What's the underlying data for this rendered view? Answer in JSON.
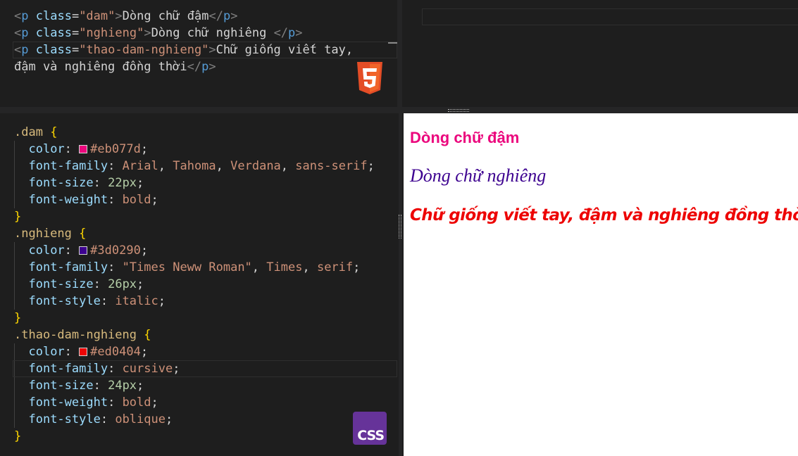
{
  "html_editor": {
    "lines": [
      [
        {
          "cls": "tag",
          "t": "<"
        },
        {
          "cls": "tname",
          "t": "p"
        },
        {
          "cls": "txt",
          "t": " "
        },
        {
          "cls": "attr",
          "t": "class"
        },
        {
          "cls": "txt",
          "t": "="
        },
        {
          "cls": "str",
          "t": "\"dam\""
        },
        {
          "cls": "tag",
          "t": ">"
        },
        {
          "cls": "txt",
          "t": "Dòng chữ đậm"
        },
        {
          "cls": "tag",
          "t": "</"
        },
        {
          "cls": "tname",
          "t": "p"
        },
        {
          "cls": "tag",
          "t": ">"
        }
      ],
      [
        {
          "cls": "tag",
          "t": "<"
        },
        {
          "cls": "tname",
          "t": "p"
        },
        {
          "cls": "txt",
          "t": " "
        },
        {
          "cls": "attr",
          "t": "class"
        },
        {
          "cls": "txt",
          "t": "="
        },
        {
          "cls": "str",
          "t": "\"nghieng\""
        },
        {
          "cls": "tag",
          "t": ">"
        },
        {
          "cls": "txt",
          "t": "Dòng chữ nghiêng "
        },
        {
          "cls": "tag",
          "t": "</"
        },
        {
          "cls": "tname",
          "t": "p"
        },
        {
          "cls": "tag",
          "t": ">"
        }
      ],
      [
        {
          "cls": "tag",
          "t": "<"
        },
        {
          "cls": "tname",
          "t": "p"
        },
        {
          "cls": "txt",
          "t": " "
        },
        {
          "cls": "attr",
          "t": "class"
        },
        {
          "cls": "txt",
          "t": "="
        },
        {
          "cls": "str",
          "t": "\"thao-dam-nghieng\""
        },
        {
          "cls": "tag",
          "t": ">"
        },
        {
          "cls": "txt",
          "t": "Chữ giống viết tay,"
        }
      ],
      [
        {
          "cls": "txt",
          "t": "đậm và nghiêng đồng thời"
        },
        {
          "cls": "tag",
          "t": "</"
        },
        {
          "cls": "tname",
          "t": "p"
        },
        {
          "cls": "tag",
          "t": ">"
        }
      ]
    ]
  },
  "css_editor": {
    "lines": [
      [
        {
          "cls": "sel",
          "t": ".dam"
        },
        {
          "cls": "txt",
          "t": " "
        },
        {
          "cls": "brace",
          "t": "{"
        }
      ],
      [
        {
          "cls": "txt",
          "t": "  "
        },
        {
          "cls": "prop",
          "t": "color"
        },
        {
          "cls": "punc",
          "t": ": "
        },
        {
          "swatch": "#eb077d"
        },
        {
          "cls": "val",
          "t": "#eb077d"
        },
        {
          "cls": "punc",
          "t": ";"
        }
      ],
      [
        {
          "cls": "txt",
          "t": "  "
        },
        {
          "cls": "prop",
          "t": "font-family"
        },
        {
          "cls": "punc",
          "t": ": "
        },
        {
          "cls": "val",
          "t": "Arial"
        },
        {
          "cls": "punc",
          "t": ", "
        },
        {
          "cls": "val",
          "t": "Tahoma"
        },
        {
          "cls": "punc",
          "t": ", "
        },
        {
          "cls": "val",
          "t": "Verdana"
        },
        {
          "cls": "punc",
          "t": ", "
        },
        {
          "cls": "val",
          "t": "sans-serif"
        },
        {
          "cls": "punc",
          "t": ";"
        }
      ],
      [
        {
          "cls": "txt",
          "t": "  "
        },
        {
          "cls": "prop",
          "t": "font-size"
        },
        {
          "cls": "punc",
          "t": ": "
        },
        {
          "cls": "num",
          "t": "22px"
        },
        {
          "cls": "punc",
          "t": ";"
        }
      ],
      [
        {
          "cls": "txt",
          "t": "  "
        },
        {
          "cls": "prop",
          "t": "font-weight"
        },
        {
          "cls": "punc",
          "t": ": "
        },
        {
          "cls": "val",
          "t": "bold"
        },
        {
          "cls": "punc",
          "t": ";"
        }
      ],
      [
        {
          "cls": "brace",
          "t": "}"
        }
      ],
      [
        {
          "cls": "sel",
          "t": ".nghieng"
        },
        {
          "cls": "txt",
          "t": " "
        },
        {
          "cls": "brace",
          "t": "{"
        }
      ],
      [
        {
          "cls": "txt",
          "t": "  "
        },
        {
          "cls": "prop",
          "t": "color"
        },
        {
          "cls": "punc",
          "t": ": "
        },
        {
          "swatch": "#3d0290"
        },
        {
          "cls": "val",
          "t": "#3d0290"
        },
        {
          "cls": "punc",
          "t": ";"
        }
      ],
      [
        {
          "cls": "txt",
          "t": "  "
        },
        {
          "cls": "prop",
          "t": "font-family"
        },
        {
          "cls": "punc",
          "t": ": "
        },
        {
          "cls": "val",
          "t": "\"Times Neww Roman\""
        },
        {
          "cls": "punc",
          "t": ", "
        },
        {
          "cls": "val",
          "t": "Times"
        },
        {
          "cls": "punc",
          "t": ", "
        },
        {
          "cls": "val",
          "t": "serif"
        },
        {
          "cls": "punc",
          "t": ";"
        }
      ],
      [
        {
          "cls": "txt",
          "t": "  "
        },
        {
          "cls": "prop",
          "t": "font-size"
        },
        {
          "cls": "punc",
          "t": ": "
        },
        {
          "cls": "num",
          "t": "26px"
        },
        {
          "cls": "punc",
          "t": ";"
        }
      ],
      [
        {
          "cls": "txt",
          "t": "  "
        },
        {
          "cls": "prop",
          "t": "font-style"
        },
        {
          "cls": "punc",
          "t": ": "
        },
        {
          "cls": "val",
          "t": "italic"
        },
        {
          "cls": "punc",
          "t": ";"
        }
      ],
      [
        {
          "cls": "brace",
          "t": "}"
        }
      ],
      [
        {
          "cls": "sel",
          "t": ".thao-dam-nghieng"
        },
        {
          "cls": "txt",
          "t": " "
        },
        {
          "cls": "brace",
          "t": "{"
        }
      ],
      [
        {
          "cls": "txt",
          "t": "  "
        },
        {
          "cls": "prop",
          "t": "color"
        },
        {
          "cls": "punc",
          "t": ": "
        },
        {
          "swatch": "#ed0404"
        },
        {
          "cls": "val",
          "t": "#ed0404"
        },
        {
          "cls": "punc",
          "t": ";"
        }
      ],
      [
        {
          "cls": "txt",
          "t": "  "
        },
        {
          "cls": "prop",
          "t": "font-family"
        },
        {
          "cls": "punc",
          "t": ": "
        },
        {
          "cls": "val",
          "t": "cursive"
        },
        {
          "cls": "punc",
          "t": ";"
        }
      ],
      [
        {
          "cls": "txt",
          "t": "  "
        },
        {
          "cls": "prop",
          "t": "font-size"
        },
        {
          "cls": "punc",
          "t": ": "
        },
        {
          "cls": "num",
          "t": "24px"
        },
        {
          "cls": "punc",
          "t": ";"
        }
      ],
      [
        {
          "cls": "txt",
          "t": "  "
        },
        {
          "cls": "prop",
          "t": "font-weight"
        },
        {
          "cls": "punc",
          "t": ": "
        },
        {
          "cls": "val",
          "t": "bold"
        },
        {
          "cls": "punc",
          "t": ";"
        }
      ],
      [
        {
          "cls": "txt",
          "t": "  "
        },
        {
          "cls": "prop",
          "t": "font-style"
        },
        {
          "cls": "punc",
          "t": ": "
        },
        {
          "cls": "val",
          "t": "oblique"
        },
        {
          "cls": "punc",
          "t": ";"
        }
      ],
      [
        {
          "cls": "brace",
          "t": "}"
        }
      ]
    ]
  },
  "badges": {
    "html_icon": "html5-icon",
    "css_label": "CSS"
  },
  "preview": {
    "dam": "Dòng chữ đậm",
    "nghieng": "Dòng chữ nghiêng",
    "thao_dam_nghieng": "Chữ giống viết tay, đậm và nghiêng đồng thời"
  },
  "colors": {
    "dam": "#eb077d",
    "nghieng": "#3d0290",
    "thao_dam_nghieng": "#ed0404",
    "editor_bg": "#1e1e1e",
    "css_badge": "#663399",
    "html5_badge": "#e44d26"
  }
}
